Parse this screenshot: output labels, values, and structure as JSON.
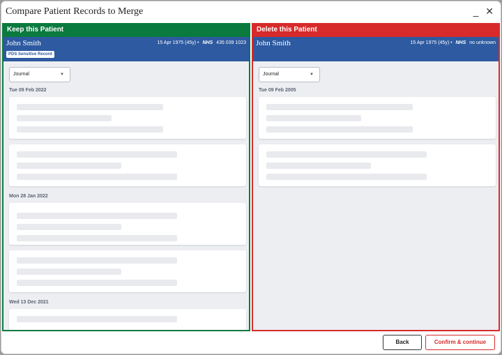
{
  "window": {
    "title": "Compare Patient Records to Merge",
    "minimize_glyph": "_",
    "close_glyph": "✕"
  },
  "keep": {
    "heading": "Keep this Patient",
    "patient": {
      "name": "John Smith",
      "dob": "15 Apr 1975 (45y) •",
      "nhs_label": "NHS",
      "nhs_number": "435 039 1023",
      "badge": "PDS Sensitive Record"
    },
    "filter": {
      "selected": "Journal"
    },
    "dates": [
      "Tue 09 Feb 2022",
      "Mon 28 Jan 2022",
      "Wed 13 Dec 2021"
    ]
  },
  "delete": {
    "heading": "Delete this Patient",
    "patient": {
      "name": "John Smith",
      "dob": "15 Apr 1975 (45y) •",
      "nhs_label": "NHS",
      "nhs_number": "no unknown"
    },
    "filter": {
      "selected": "Journal"
    },
    "dates": [
      "Tue 09 Feb 2005"
    ]
  },
  "footer": {
    "back_label": "Back",
    "confirm_label": "Confirm & continue"
  },
  "colors": {
    "keep": "#0a7a3e",
    "delete": "#d72a2a",
    "banner": "#2d5aa0"
  },
  "icons": {
    "dropdown": "chevron-down-icon"
  }
}
